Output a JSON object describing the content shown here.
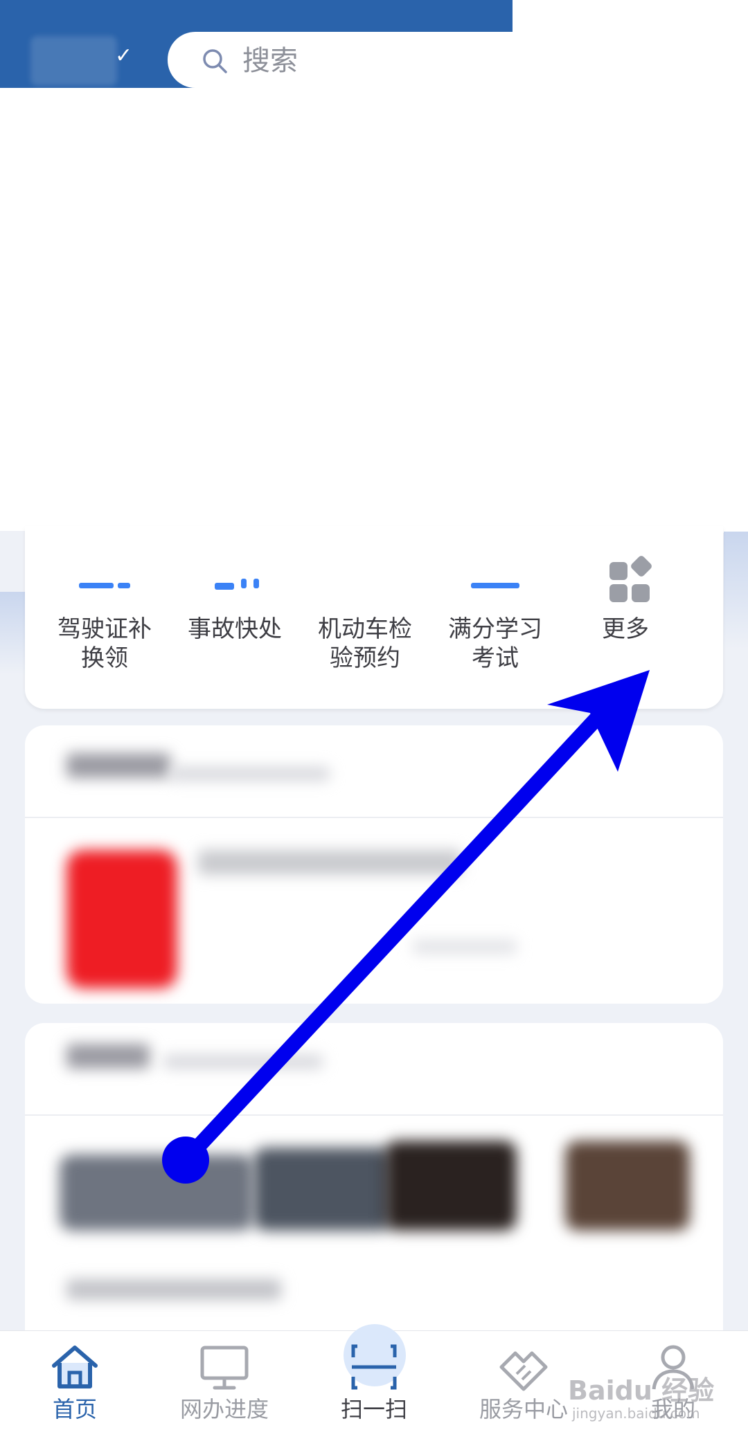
{
  "header": {
    "search_placeholder": "搜索"
  },
  "services": [
    {
      "label": "驾驶证补\n换领"
    },
    {
      "label": "事故快处"
    },
    {
      "label": "机动车检\n验预约"
    },
    {
      "label": "满分学习\n考试"
    },
    {
      "label": "更多"
    }
  ],
  "tabbar": {
    "tabs": [
      {
        "label": "首页",
        "active": true
      },
      {
        "label": "网办进度"
      },
      {
        "label": "扫一扫"
      },
      {
        "label": "服务中心"
      },
      {
        "label": "我的"
      }
    ]
  },
  "watermark": {
    "brand": "Baidu 经验",
    "url": "jingyan.baidu.com"
  },
  "colors": {
    "primary": "#2a63ab",
    "annotation_arrow": "#0000ee"
  }
}
